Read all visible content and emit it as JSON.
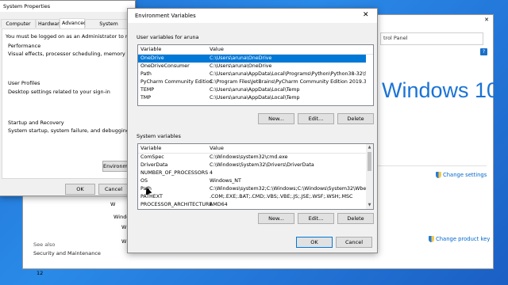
{
  "sysprops": {
    "title": "System Properties",
    "tabs": [
      "Computer Name",
      "Hardware",
      "Advanced",
      "System Protection"
    ],
    "admin_note": "You must be logged on as an Administrator to make most of th",
    "perf_title": "Performance",
    "perf_desc": "Visual effects, processor scheduling, memory usage, and virt",
    "profiles_title": "User Profiles",
    "profiles_desc": "Desktop settings related to your sign-in",
    "startup_title": "Startup and Recovery",
    "startup_desc": "System startup, system failure, and debugging information",
    "env_button": "Environmen",
    "ok": "OK",
    "cancel": "Cancel"
  },
  "controlpanel": {
    "search_partial": "trol Panel",
    "logo_text": "Windows 10",
    "change_settings": "Change settings",
    "change_product_key": "Change product key",
    "see_also": "See also",
    "security": "Security and Maintenance",
    "frag1": "Windo",
    "frag2": "12"
  },
  "envvars": {
    "title": "Environment Variables",
    "close_glyph": "✕",
    "user_label": "User variables for aruna",
    "system_label": "System variables",
    "col_variable": "Variable",
    "col_value": "Value",
    "user_vars": [
      {
        "name": "OneDrive",
        "value": "C:\\Users\\aruna\\OneDrive"
      },
      {
        "name": "OneDriveConsumer",
        "value": "C:\\Users\\aruna\\OneDrive"
      },
      {
        "name": "Path",
        "value": "C:\\Users\\aruna\\AppData\\Local\\Programs\\Python\\Python38-32\\Scr..."
      },
      {
        "name": "PyCharm Community Edition",
        "value": "C:\\Program Files\\JetBrains\\PyCharm Community Edition 2019.3.1\\b..."
      },
      {
        "name": "TEMP",
        "value": "C:\\Users\\aruna\\AppData\\Local\\Temp"
      },
      {
        "name": "TMP",
        "value": "C:\\Users\\aruna\\AppData\\Local\\Temp"
      }
    ],
    "system_vars": [
      {
        "name": "ComSpec",
        "value": "C:\\Windows\\system32\\cmd.exe"
      },
      {
        "name": "DriverData",
        "value": "C:\\Windows\\System32\\Drivers\\DriverData"
      },
      {
        "name": "NUMBER_OF_PROCESSORS",
        "value": "4"
      },
      {
        "name": "OS",
        "value": "Windows_NT"
      },
      {
        "name": "Path",
        "value": "C:\\Windows\\system32;C:\\Windows;C:\\Windows\\System32\\Wbem;..."
      },
      {
        "name": "PATHEXT",
        "value": ".COM;.EXE;.BAT;.CMD;.VBS;.VBE;.JS;.JSE;.WSF;.WSH;.MSC"
      },
      {
        "name": "PROCESSOR_ARCHITECTURE",
        "value": "AMD64"
      }
    ],
    "new": "New...",
    "edit": "Edit...",
    "delete": "Delete",
    "ok": "OK",
    "cancel": "Cancel"
  }
}
